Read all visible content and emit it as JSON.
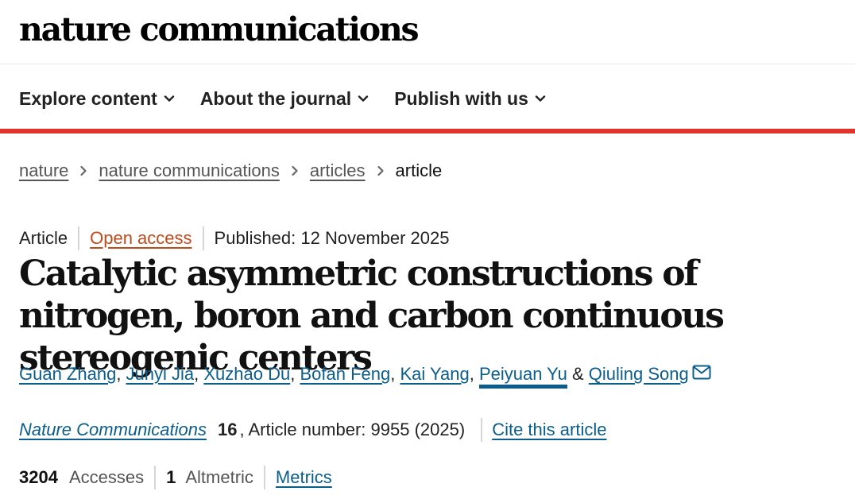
{
  "site": {
    "logo": "nature communications"
  },
  "nav": {
    "items": [
      {
        "label": "Explore content"
      },
      {
        "label": "About the journal"
      },
      {
        "label": "Publish with us"
      }
    ]
  },
  "breadcrumb": {
    "items": [
      "nature",
      "nature communications",
      "articles"
    ],
    "current": "article"
  },
  "article": {
    "type": "Article",
    "access": "Open access",
    "published": "Published: 12 November 2025",
    "title": "Catalytic asymmetric constructions of nitrogen, boron and carbon continuous stereogenic centers",
    "authors": [
      "Guan Zhang",
      "Junyi Jia",
      "Xuzhao Du",
      "Bofan Feng",
      "Kai Yang",
      "Peiyuan Yu",
      "Qiuling Song"
    ],
    "author_separator": ", ",
    "author_last_separator": " & ",
    "journal": "Nature Communications",
    "volume": "16",
    "article_number": ", Article number: 9955 (2025)",
    "cite_label": "Cite this article"
  },
  "metrics": {
    "accesses_count": "3204",
    "accesses_label": "Accesses",
    "altmetric_count": "1",
    "altmetric_label": "Altmetric",
    "metrics_link": "Metrics"
  },
  "colors": {
    "accent_red": "#e0332c",
    "link_blue": "#0b5d8c",
    "open_access": "#c04a1a"
  },
  "icons": {
    "nav_dropdown": "chevron-down-icon",
    "breadcrumb_separator": "chevron-right-icon",
    "corresponding_author": "mail-icon"
  }
}
